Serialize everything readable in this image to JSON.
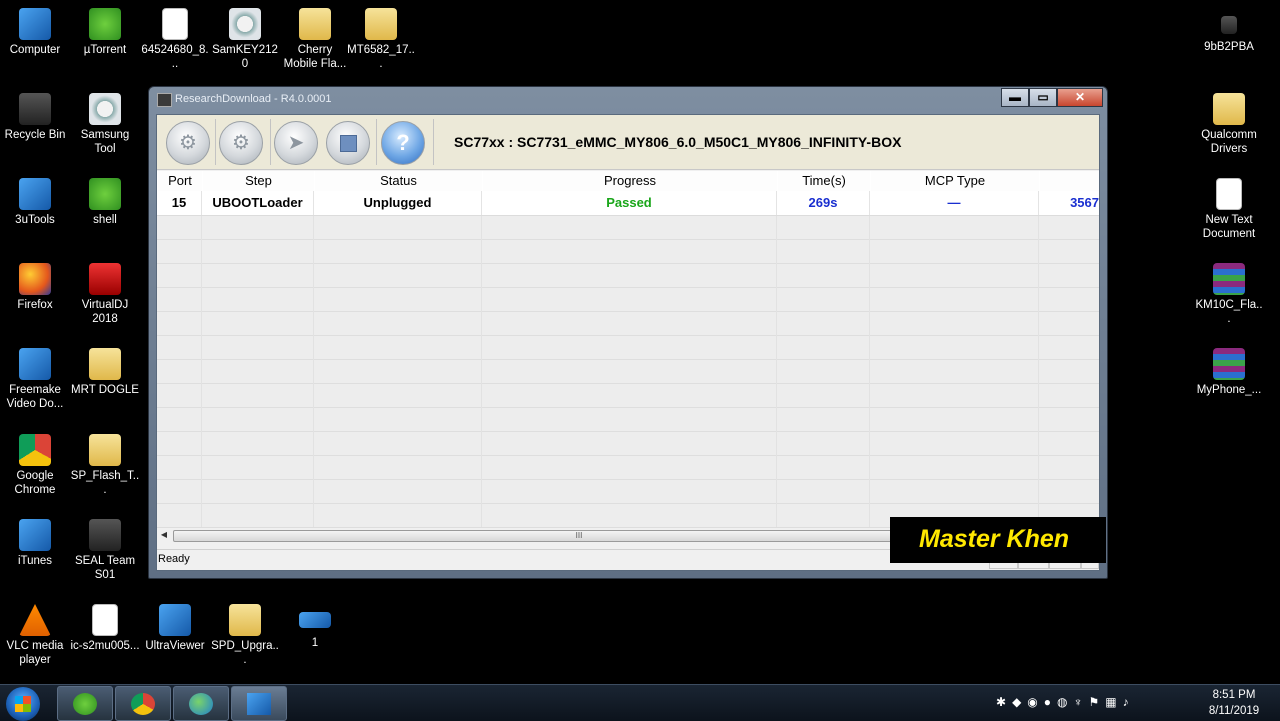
{
  "desktop": {
    "icons": [
      {
        "label": "Computer"
      },
      {
        "label": "µTorrent"
      },
      {
        "label": "64524680_8..."
      },
      {
        "label": "SamKEY2120"
      },
      {
        "label": "Cherry Mobile Fla..."
      },
      {
        "label": "MT6582_17..."
      },
      {
        "label": "9bB2PBA"
      },
      {
        "label": "Recycle Bin"
      },
      {
        "label": "Samsung Tool"
      },
      {
        "label": "Qualcomm Drivers"
      },
      {
        "label": "3uTools"
      },
      {
        "label": "shell"
      },
      {
        "label": "New Text Document"
      },
      {
        "label": "Firefox"
      },
      {
        "label": "VirtualDJ 2018"
      },
      {
        "label": "KM10C_Fla..."
      },
      {
        "label": "Freemake Video Do..."
      },
      {
        "label": "MRT DOGLE"
      },
      {
        "label": "MyPhone_..."
      },
      {
        "label": "Google Chrome"
      },
      {
        "label": "SP_Flash_T..."
      },
      {
        "label": "iTunes"
      },
      {
        "label": "SEAL Team S01"
      },
      {
        "label": "VLC media player"
      },
      {
        "label": "ic-s2mu005..."
      },
      {
        "label": "UltraViewer"
      },
      {
        "label": "SPD_Upgra..."
      },
      {
        "label": "1"
      }
    ]
  },
  "window": {
    "title": "ResearchDownload - R4.0.0001",
    "buttons": {
      "minimize": "▬",
      "maximize": "▭",
      "close": "✕"
    },
    "toolbar": {
      "buttons": [
        {
          "icon": "settings-gear-icon"
        },
        {
          "icon": "gears-icon"
        },
        {
          "icon": "start-download-icon"
        },
        {
          "icon": "stop-icon"
        },
        {
          "icon": "help-icon",
          "glyph": "?"
        }
      ],
      "firmware_label": "SC77xx : SC7731_eMMC_MY806_6.0_M50C1_MY806_INFINITY-BOX"
    },
    "table": {
      "columns": [
        "Port",
        "Step",
        "Status",
        "Progress",
        "Time(s)",
        "MCP Type",
        ""
      ],
      "rows": [
        {
          "port": "15",
          "step": "UBOOTLoader",
          "status": "Unplugged",
          "progress": "Passed",
          "time": "269s",
          "mcp_type": "—",
          "extra": "3567"
        }
      ],
      "scroll_thumb_label": "III"
    },
    "status_text": "Ready"
  },
  "watermark": {
    "text": "Master Khen"
  },
  "taskbar": {
    "apps": [
      {
        "name": "utorrent"
      },
      {
        "name": "chrome"
      },
      {
        "name": "ultraviewer"
      },
      {
        "name": "research-download"
      }
    ],
    "clock": {
      "time": "8:51 PM",
      "date": "8/11/2019"
    }
  },
  "colors": {
    "passed": "#1aa61a",
    "time": "#1a2fd0",
    "watermark_text": "#ffe800"
  }
}
